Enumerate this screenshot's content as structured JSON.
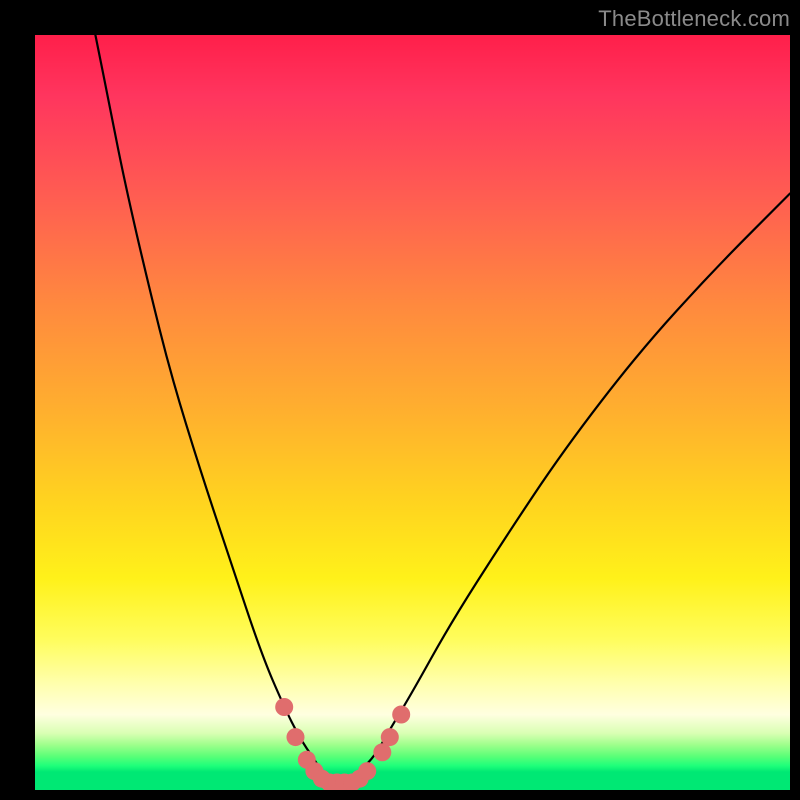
{
  "watermark": {
    "text": "TheBottleneck.com"
  },
  "chart_data": {
    "type": "line",
    "title": "",
    "xlabel": "",
    "ylabel": "",
    "xlim": [
      0,
      100
    ],
    "ylim": [
      0,
      100
    ],
    "series": [
      {
        "name": "bottleneck-curve",
        "x": [
          8,
          10,
          12,
          15,
          18,
          22,
          26,
          30,
          33,
          35,
          37,
          38,
          39,
          40,
          41,
          42,
          43,
          45,
          47,
          50,
          55,
          62,
          70,
          80,
          90,
          100
        ],
        "y": [
          100,
          90,
          80,
          67,
          55,
          42,
          30,
          18,
          11,
          7,
          4,
          2.5,
          1.5,
          1,
          1,
          1.5,
          2.5,
          4.5,
          8,
          13,
          22,
          33,
          45,
          58,
          69,
          79
        ]
      }
    ],
    "markers": {
      "name": "highlight-dots",
      "color": "#e06d6d",
      "points": [
        {
          "x": 33.0,
          "y": 11
        },
        {
          "x": 34.5,
          "y": 7
        },
        {
          "x": 36.0,
          "y": 4
        },
        {
          "x": 37.0,
          "y": 2.5
        },
        {
          "x": 38.0,
          "y": 1.5
        },
        {
          "x": 39.0,
          "y": 1
        },
        {
          "x": 40.0,
          "y": 1
        },
        {
          "x": 41.0,
          "y": 1
        },
        {
          "x": 42.0,
          "y": 1
        },
        {
          "x": 43.0,
          "y": 1.5
        },
        {
          "x": 44.0,
          "y": 2.5
        },
        {
          "x": 46.0,
          "y": 5
        },
        {
          "x": 47.0,
          "y": 7
        },
        {
          "x": 48.5,
          "y": 10
        }
      ]
    },
    "gradient_stops": [
      {
        "pos": 0,
        "color": "#ff1f4a"
      },
      {
        "pos": 50,
        "color": "#ffb02e"
      },
      {
        "pos": 80,
        "color": "#fffd5c"
      },
      {
        "pos": 97,
        "color": "#00e874"
      }
    ]
  }
}
